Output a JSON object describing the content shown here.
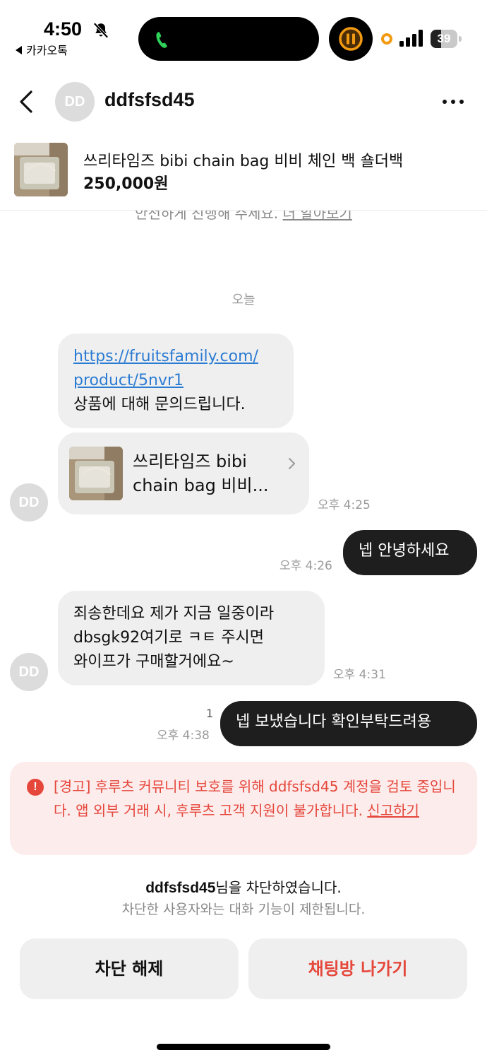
{
  "status_bar": {
    "time": "4:50",
    "back_app": "카카오톡",
    "battery": "39",
    "icons": [
      "bell-off-icon",
      "phone-icon",
      "pause-icon",
      "signal-icon",
      "battery-icon"
    ],
    "call_color": "#2fd158",
    "recording_color": "#f29a12"
  },
  "header": {
    "avatar_initials": "DD",
    "username": "ddfsfsd45"
  },
  "product": {
    "title": "쓰리타임즈 bibi chain bag 비비 체인 백 숄더백",
    "price": "250,000원"
  },
  "notice": {
    "text": "안전하게 진행해 주세요.",
    "link": "더 알아보기"
  },
  "chat": {
    "date_label": "오늘",
    "messages": [
      {
        "link_line1": "https://fruitsfamily.com/",
        "link_line2": "product/5nvr1",
        "text": "상품에 대해 문의드립니다.",
        "card_title": "쓰리타임즈 bibi chain bag 비비...",
        "avatar": "DD",
        "time": "오후 4:25"
      },
      {
        "text": "넵 안녕하세요",
        "time": "오후 4:26"
      },
      {
        "line1": "죄송한데요 제가 지금 일중이라",
        "line2": "dbsgk92여기로 ㅋㅌ 주시면",
        "line3": "와이프가 구매할거에요~",
        "avatar": "DD",
        "time": "오후 4:31"
      },
      {
        "text": "넵 보냈습니다 확인부탁드려용",
        "time": "오후 4:38",
        "read": "1"
      }
    ]
  },
  "warning": {
    "text": "[경고] 후루츠 커뮤니티 보호를 위해 ddfsfsd45 계정을 검토 중입니다. 앱 외부 거래 시, 후루츠 고객 지원이 불가합니다.",
    "link": "신고하기",
    "color": "#e5473b"
  },
  "blocked": {
    "user": "ddfsfsd45",
    "suffix": "님을 차단하였습니다.",
    "sub": "차단한 사용자와는 대화 기능이 제한됩니다."
  },
  "actions": {
    "unblock": "차단 해제",
    "leave": "채팅방 나가기"
  }
}
